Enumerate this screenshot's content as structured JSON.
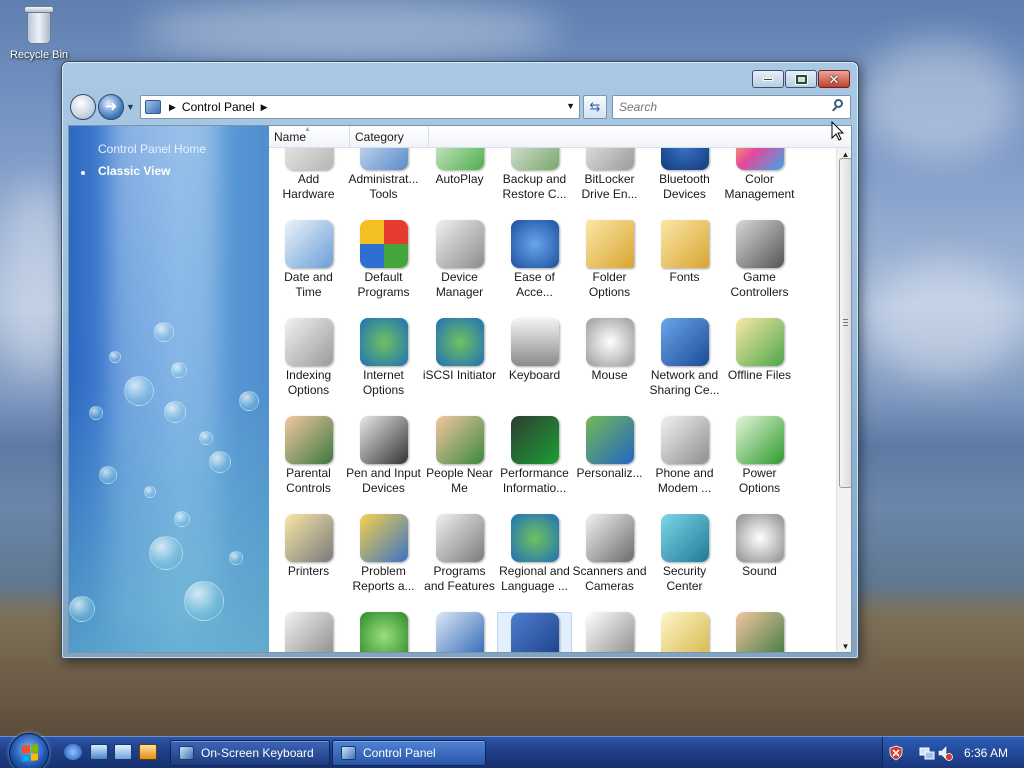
{
  "desktop": {
    "recycle_bin_label": "Recycle Bin"
  },
  "window": {
    "title": "Control Panel",
    "buttons": {
      "minimize": "minimize",
      "maximize": "maximize",
      "close": "close"
    }
  },
  "address_bar": {
    "crumbs": [
      "Control Panel"
    ],
    "search_placeholder": "Search"
  },
  "task_pane": {
    "links": [
      "Control Panel Home",
      "Classic View"
    ]
  },
  "columns": [
    "Name",
    "Category"
  ],
  "items": [
    {
      "label": "Add Hardware",
      "icon": "add-hardware-icon"
    },
    {
      "label": "Administrat... Tools",
      "icon": "administrative-tools-icon"
    },
    {
      "label": "AutoPlay",
      "icon": "autoplay-icon"
    },
    {
      "label": "Backup and Restore C...",
      "icon": "backup-icon"
    },
    {
      "label": "BitLocker Drive En...",
      "icon": "bitlocker-icon"
    },
    {
      "label": "Bluetooth Devices",
      "icon": "bluetooth-icon"
    },
    {
      "label": "Color Management",
      "icon": "color-management-icon"
    },
    {
      "label": "Date and Time",
      "icon": "date-time-icon"
    },
    {
      "label": "Default Programs",
      "icon": "default-programs-icon"
    },
    {
      "label": "Device Manager",
      "icon": "device-manager-icon"
    },
    {
      "label": "Ease of Acce...",
      "icon": "ease-of-access-icon"
    },
    {
      "label": "Folder Options",
      "icon": "folder-options-icon"
    },
    {
      "label": "Fonts",
      "icon": "fonts-icon"
    },
    {
      "label": "Game Controllers",
      "icon": "game-controllers-icon"
    },
    {
      "label": "Indexing Options",
      "icon": "indexing-options-icon"
    },
    {
      "label": "Internet Options",
      "icon": "internet-options-icon"
    },
    {
      "label": "iSCSI Initiator",
      "icon": "iscsi-icon"
    },
    {
      "label": "Keyboard",
      "icon": "keyboard-icon"
    },
    {
      "label": "Mouse",
      "icon": "mouse-icon"
    },
    {
      "label": "Network and Sharing Ce...",
      "icon": "network-icon"
    },
    {
      "label": "Offline Files",
      "icon": "offline-files-icon"
    },
    {
      "label": "Parental Controls",
      "icon": "parental-controls-icon"
    },
    {
      "label": "Pen and Input Devices",
      "icon": "pen-icon"
    },
    {
      "label": "People Near Me",
      "icon": "people-near-me-icon"
    },
    {
      "label": "Performance Informatio...",
      "icon": "performance-icon"
    },
    {
      "label": "Personaliz...",
      "icon": "personalization-icon"
    },
    {
      "label": "Phone and Modem ...",
      "icon": "phone-modem-icon"
    },
    {
      "label": "Power Options",
      "icon": "power-options-icon"
    },
    {
      "label": "Printers",
      "icon": "printers-icon"
    },
    {
      "label": "Problem Reports a...",
      "icon": "problem-reports-icon"
    },
    {
      "label": "Programs and Features",
      "icon": "programs-features-icon"
    },
    {
      "label": "Regional and Language ...",
      "icon": "regional-language-icon"
    },
    {
      "label": "Scanners and Cameras",
      "icon": "scanners-cameras-icon"
    },
    {
      "label": "Security Center",
      "icon": "security-center-icon"
    },
    {
      "label": "Sound",
      "icon": "sound-icon"
    },
    {
      "label": "",
      "icon": "speech-recognition-icon"
    },
    {
      "label": "",
      "icon": "sync-center-icon"
    },
    {
      "label": "",
      "icon": "system-icon"
    },
    {
      "label": "",
      "icon": "tablet-pc-icon"
    },
    {
      "label": "",
      "icon": "taskbar-icon"
    },
    {
      "label": "",
      "icon": "text-to-speech-icon"
    },
    {
      "label": "",
      "icon": "user-accounts-icon"
    }
  ],
  "taskbar": {
    "buttons": [
      {
        "label": "On-Screen Keyboard",
        "active": false
      },
      {
        "label": "Control Panel",
        "active": true
      }
    ],
    "clock": "6:36 AM"
  }
}
